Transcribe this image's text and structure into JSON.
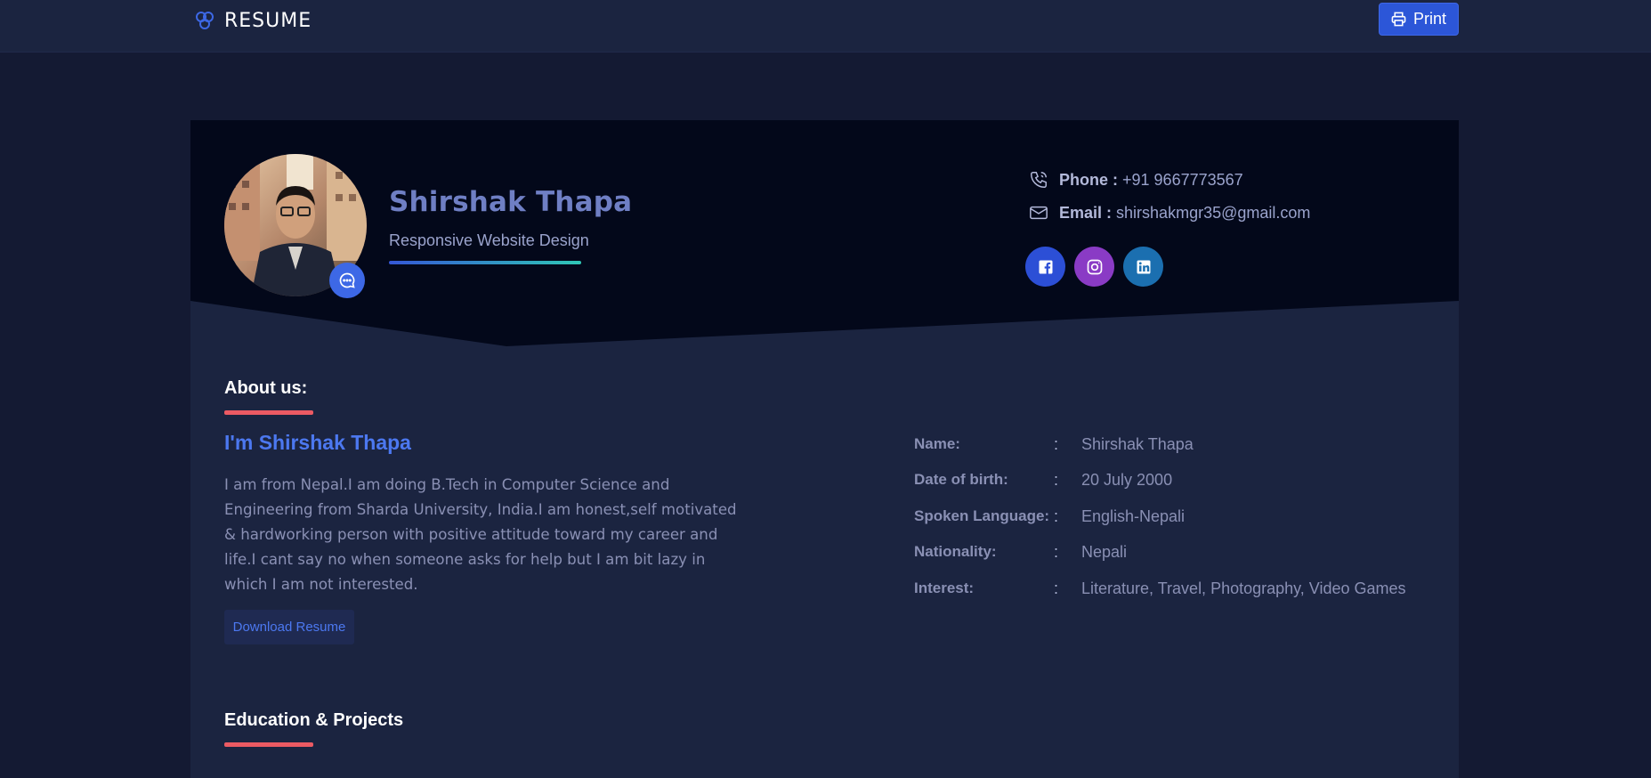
{
  "nav": {
    "brand": "RESUME",
    "print_label": "Print"
  },
  "profile": {
    "name": "Shirshak Thapa",
    "subtitle": "Responsive Website Design",
    "phone_label": "Phone :",
    "phone": "+91 9667773567",
    "email_label": "Email :",
    "email": "shirshakmgr35@gmail.com"
  },
  "about": {
    "section_title": "About us:",
    "heading": "I'm Shirshak Thapa",
    "text": "I am from Nepal.I am doing B.Tech in Computer Science and Engineering from Sharda University, India.I am honest,self motivated & hardworking person with positive attitude toward my career and life.I cant say no when someone asks for help but I am bit lazy in which I am not interested.",
    "download_label": "Download Resume"
  },
  "info": [
    {
      "key": "Name:",
      "sep": ":",
      "value": "Shirshak Thapa"
    },
    {
      "key": "Date of birth:",
      "sep": ":",
      "value": "20 July 2000"
    },
    {
      "key": "Spoken Language:",
      "sep": ":",
      "value": "English-Nepali"
    },
    {
      "key": "Nationality:",
      "sep": ":",
      "value": "Nepali"
    },
    {
      "key": "Interest:",
      "sep": ":",
      "value": "Literature, Travel, Photography, Video Games"
    }
  ],
  "education": {
    "section_title": "Education & Projects"
  },
  "colors": {
    "accent": "#2c56d8",
    "underline": "#ec5a63",
    "heading_blue": "#4c78f0",
    "facebook": "#2c4fd6",
    "instagram": "#8a3bc5",
    "linkedin": "#1b6fb0"
  },
  "icons": {
    "brand": "three-circles-logo-icon",
    "print": "printer-icon",
    "chat": "chat-bubble-icon",
    "phone": "phone-icon",
    "email": "envelope-icon",
    "facebook": "facebook-icon",
    "instagram": "instagram-icon",
    "linkedin": "linkedin-icon"
  }
}
